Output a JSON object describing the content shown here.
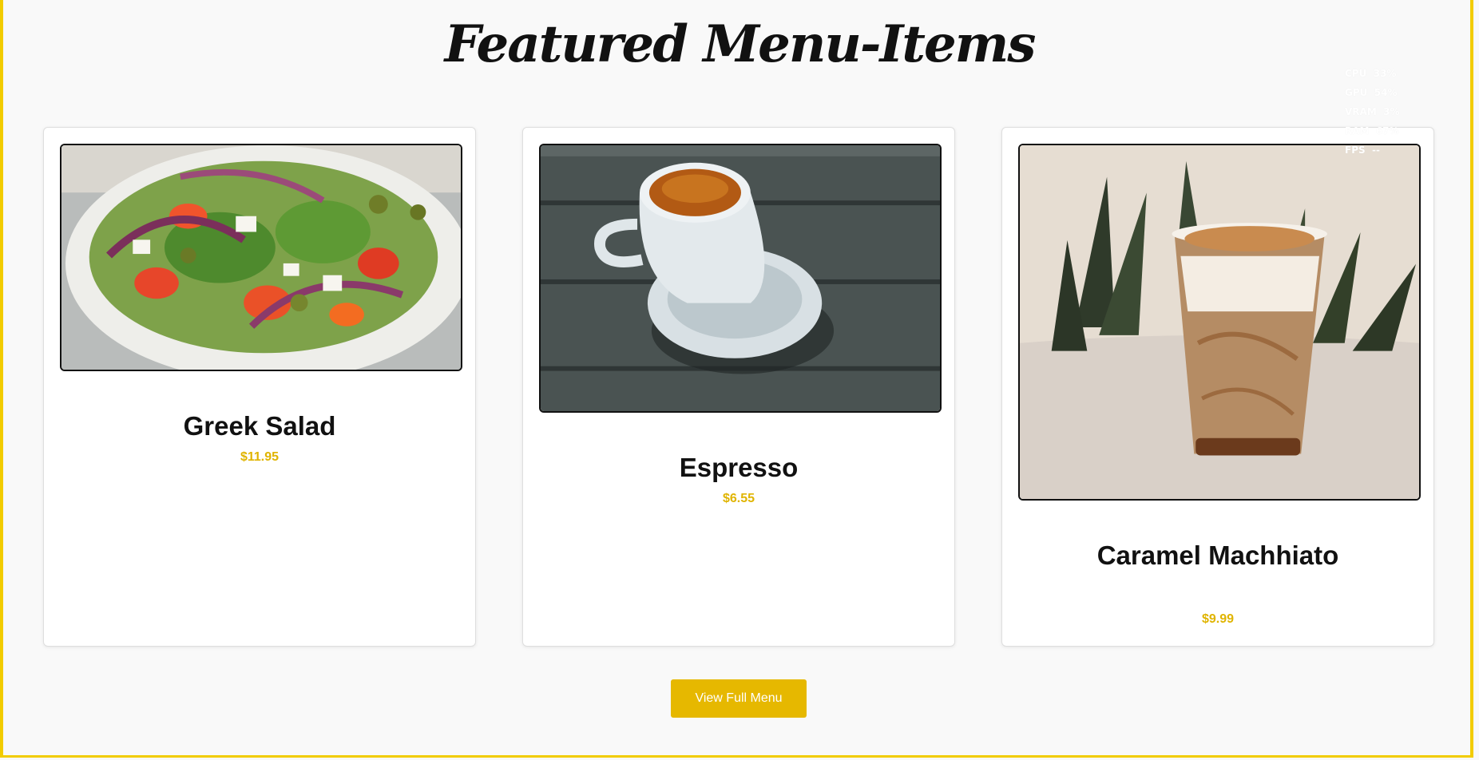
{
  "section": {
    "heading": "Featured Menu-Items"
  },
  "items": [
    {
      "name": "Greek Salad",
      "price": "$11.95",
      "image": "greek-salad-photo"
    },
    {
      "name": "Espresso",
      "price": "$6.55",
      "image": "espresso-photo"
    },
    {
      "name": "Caramel Machhiato",
      "price": "$9.99",
      "image": "caramel-macchiato-photo"
    }
  ],
  "cta": {
    "label": "View Full Menu"
  },
  "colors": {
    "accent": "#e6b800",
    "frame": "#f2cc00",
    "price": "#e0b400"
  },
  "overlay": [
    {
      "label": "CPU",
      "value": "33%"
    },
    {
      "label": "GPU",
      "value": "54%"
    },
    {
      "label": "VRAM",
      "value": "3%"
    },
    {
      "label": "RAM",
      "value": "67%"
    },
    {
      "label": "FPS",
      "value": "--"
    }
  ]
}
